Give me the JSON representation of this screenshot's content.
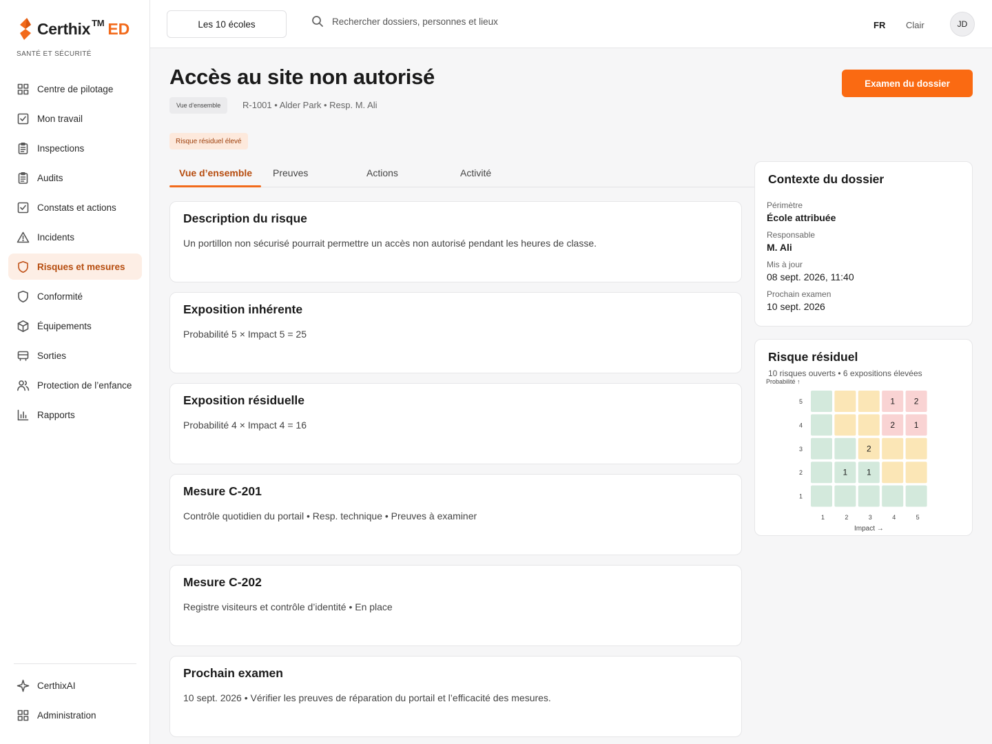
{
  "brand": {
    "name": "Certhix",
    "tm": "TM",
    "suffix": "ED",
    "subtitle": "SANTÉ ET SÉCURITÉ",
    "accent": "#f26a1b"
  },
  "nav": {
    "items": [
      {
        "label": "Centre de pilotage",
        "icon": "grid-icon"
      },
      {
        "label": "Mon travail",
        "icon": "checkbox-icon"
      },
      {
        "label": "Inspections",
        "icon": "clipboard-icon"
      },
      {
        "label": "Audits",
        "icon": "clipboard-icon"
      },
      {
        "label": "Constats et actions",
        "icon": "checkbox-icon"
      },
      {
        "label": "Incidents",
        "icon": "warning-icon"
      },
      {
        "label": "Risques et mesures",
        "icon": "shield-icon",
        "active": true
      },
      {
        "label": "Conformité",
        "icon": "shield-icon"
      },
      {
        "label": "Équipements",
        "icon": "box-icon"
      },
      {
        "label": "Sorties",
        "icon": "bus-icon"
      },
      {
        "label": "Protection de l’enfance",
        "icon": "people-icon"
      },
      {
        "label": "Rapports",
        "icon": "bar-chart-icon"
      }
    ],
    "bottom": [
      {
        "label": "CerthixAI",
        "icon": "sparkle-icon"
      },
      {
        "label": "Administration",
        "icon": "grid-icon"
      }
    ]
  },
  "topbar": {
    "school_selector": "Les 10 écoles",
    "search_placeholder": "Rechercher dossiers, personnes et lieux",
    "lang": "FR",
    "theme": "Clair",
    "user_initials": "JD"
  },
  "page": {
    "title": "Accès au site non autorisé",
    "breadcrumb_chip": "Vue d’ensemble",
    "meta": "R-1001 • Alder Park • Resp. M. Ali",
    "primary_action": "Examen du dossier",
    "risk_badge": "Risque résiduel élevé"
  },
  "tabs": [
    {
      "label": "Vue d’ensemble",
      "active": true
    },
    {
      "label": "Preuves"
    },
    {
      "label": "Actions"
    },
    {
      "label": "Activité"
    }
  ],
  "cards": [
    {
      "title": "Description du risque",
      "body": "Un portillon non sécurisé pourrait permettre un accès non autorisé pendant les heures de classe."
    },
    {
      "title": "Exposition inhérente",
      "body": "Probabilité 5 × Impact 5 = 25"
    },
    {
      "title": "Exposition résiduelle",
      "body": "Probabilité 4 × Impact 4 = 16"
    },
    {
      "title": "Mesure C-201",
      "body": "Contrôle quotidien du portail • Resp. technique • Preuves à examiner"
    },
    {
      "title": "Mesure C-202",
      "body": "Registre visiteurs et contrôle d’identité • En place"
    },
    {
      "title": "Prochain examen",
      "body": "10 sept. 2026 • Vérifier les preuves de réparation du portail et l’efficacité des mesures."
    }
  ],
  "context": {
    "title": "Contexte du dossier",
    "rows": [
      {
        "label": "Périmètre",
        "value": "École attribuée",
        "strong": true
      },
      {
        "label": "Responsable",
        "value": "M. Ali",
        "strong": true
      },
      {
        "label": "Mis à jour",
        "value": "08 sept. 2026, 11:40"
      },
      {
        "label": "Prochain examen",
        "value": "10 sept. 2026"
      }
    ]
  },
  "residual": {
    "title": "Risque résiduel",
    "subtitle": "10 risques ouverts • 6 expositions élevées",
    "y_label": "Probabilité ↑",
    "x_label": "Impact →",
    "colors": {
      "low": "#d3e9dc",
      "medium": "#fbe6b6",
      "high": "#f9d3d3"
    }
  },
  "chart_data": {
    "type": "heatmap",
    "xlabel": "Impact →",
    "ylabel": "Probabilité ↑",
    "x_ticks": [
      "1",
      "2",
      "3",
      "4",
      "5"
    ],
    "y_ticks": [
      "5",
      "4",
      "3",
      "2",
      "1"
    ],
    "levels": [
      [
        "low",
        "medium",
        "medium",
        "high",
        "high"
      ],
      [
        "low",
        "medium",
        "medium",
        "high",
        "high"
      ],
      [
        "low",
        "low",
        "medium",
        "medium",
        "medium"
      ],
      [
        "low",
        "low",
        "low",
        "medium",
        "medium"
      ],
      [
        "low",
        "low",
        "low",
        "low",
        "low"
      ]
    ],
    "counts": [
      [
        null,
        null,
        null,
        1,
        2
      ],
      [
        null,
        null,
        null,
        2,
        1
      ],
      [
        null,
        null,
        2,
        null,
        null
      ],
      [
        null,
        1,
        1,
        null,
        null
      ],
      [
        null,
        null,
        null,
        null,
        null
      ]
    ]
  }
}
